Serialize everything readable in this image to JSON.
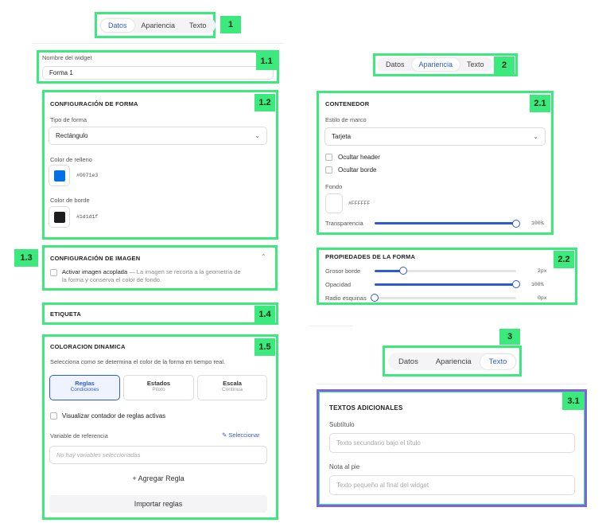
{
  "annotations": {
    "b1": "1",
    "b11": "1.1",
    "b12": "1.2",
    "b13": "1.3",
    "b14": "1.4",
    "b15": "1.5",
    "b2": "2",
    "b21": "2.1",
    "b22": "2.2",
    "b3": "3",
    "b31": "3.1"
  },
  "panel1": {
    "tabs": [
      "Datos",
      "Apariencia",
      "Texto"
    ],
    "widget_name_label": "Nombre del widget",
    "widget_name_value": "Forma 1",
    "shape_config": {
      "title": "CONFIGURACIÓN DE FORMA",
      "shape_type_label": "Tipo de forma",
      "shape_type_value": "Rectángulo",
      "fill_label": "Color de relleno",
      "fill_hex": "#0071e3",
      "border_label": "Color de borde",
      "border_hex": "#1d1d1f"
    },
    "image_config": {
      "title": "CONFIGURACIÓN DE IMAGEN",
      "checkbox_label": "Activar imagen acoplada",
      "checkbox_desc_1": " — La imagen se recorta a la geometría de",
      "checkbox_desc_2": "la forma y conserva el color de fondo."
    },
    "label_section": {
      "title": "ETIQUETA"
    },
    "dynamic": {
      "title": "COLORACION DINAMICA",
      "description": "Selecciona como se determina el color de la forma en tiempo real.",
      "modes": [
        {
          "title": "Reglas",
          "sub": "Condiciones"
        },
        {
          "title": "Estados",
          "sub": "Piloto"
        },
        {
          "title": "Escala",
          "sub": "Continua"
        }
      ],
      "counter_label": "Visualizar contador de reglas activas",
      "ref_var_label": "Variable de referencia",
      "select_link": "Seleccionar",
      "empty_placeholder": "No hay variables seleccionadas",
      "add_rule": "+ Agregar Regla",
      "import_rules": "Importar reglas"
    }
  },
  "panel2": {
    "tabs": [
      "Datos",
      "Apariencia",
      "Texto"
    ],
    "container": {
      "title": "CONTENEDOR",
      "frame_label": "Estilo de marco",
      "frame_value": "Tarjeta",
      "hide_header": "Ocultar header",
      "hide_border": "Ocultar borde",
      "background_label": "Fondo",
      "background_hex": "#FFFFFF",
      "transparency_label": "Transparencia",
      "transparency_value": "100%",
      "transparency_level": 1.0
    },
    "shape_props": {
      "title": "PROPIEDADES DE LA FORMA",
      "rows": [
        {
          "label": "Grosor borde",
          "value": "2px",
          "level": 0.2
        },
        {
          "label": "Opacidad",
          "value": "100%",
          "level": 1.0
        },
        {
          "label": "Radio esquinas",
          "value": "0px",
          "level": 0.0
        }
      ]
    }
  },
  "panel3": {
    "tabs": [
      "Datos",
      "Apariencia",
      "Texto"
    ],
    "extra_texts": {
      "title": "TEXTOS ADICIONALES",
      "subtitle_label": "Subtítulo",
      "subtitle_placeholder": "Texto secundario bajo el título",
      "footer_label": "Nota al pie",
      "footer_placeholder": "Texto pequeño al final del widget"
    }
  },
  "colors": {
    "accent": "#2d5bd6",
    "highlight": "#3ce97c",
    "fill": "#0071e3",
    "border": "#1d1d1f"
  }
}
